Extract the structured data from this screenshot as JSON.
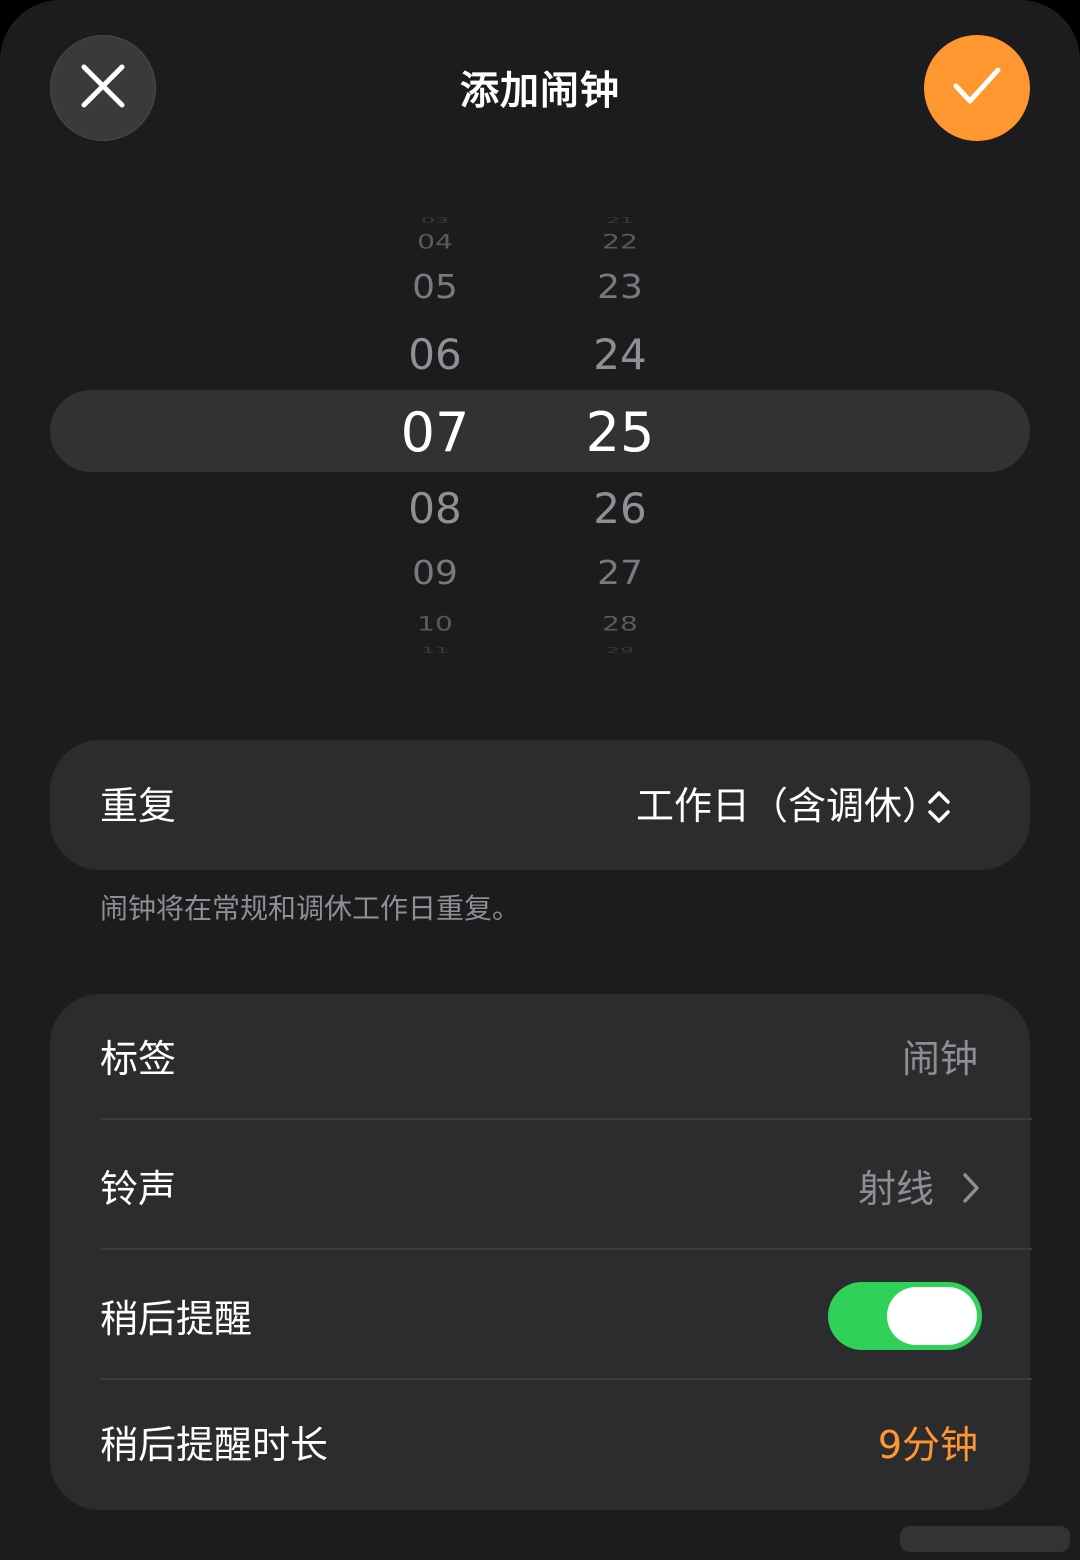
{
  "header": {
    "title": "添加闹钟",
    "close_icon": "close-icon",
    "confirm_icon": "checkmark-icon",
    "confirm_color": "#ff9730"
  },
  "picker": {
    "hours": [
      "03",
      "04",
      "05",
      "06",
      "07",
      "08",
      "09",
      "10",
      "11"
    ],
    "minutes": [
      "21",
      "22",
      "23",
      "24",
      "25",
      "26",
      "27",
      "28",
      "29"
    ],
    "selected_hour": "07",
    "selected_minute": "25"
  },
  "repeat": {
    "label": "重复",
    "value": "工作日（含调休）",
    "icon": "chevron-up-down-icon",
    "note": "闹钟将在常规和调休工作日重复。"
  },
  "settings": {
    "label_row": {
      "label": "标签",
      "placeholder": "闹钟"
    },
    "sound_row": {
      "label": "铃声",
      "value": "射线",
      "icon": "chevron-right-icon"
    },
    "snooze_row": {
      "label": "稍后提醒",
      "enabled": true,
      "toggle_color": "#30d158"
    },
    "snooze_duration_row": {
      "label": "稍后提醒时长",
      "value": "9分钟",
      "value_color": "#ff9730"
    }
  }
}
